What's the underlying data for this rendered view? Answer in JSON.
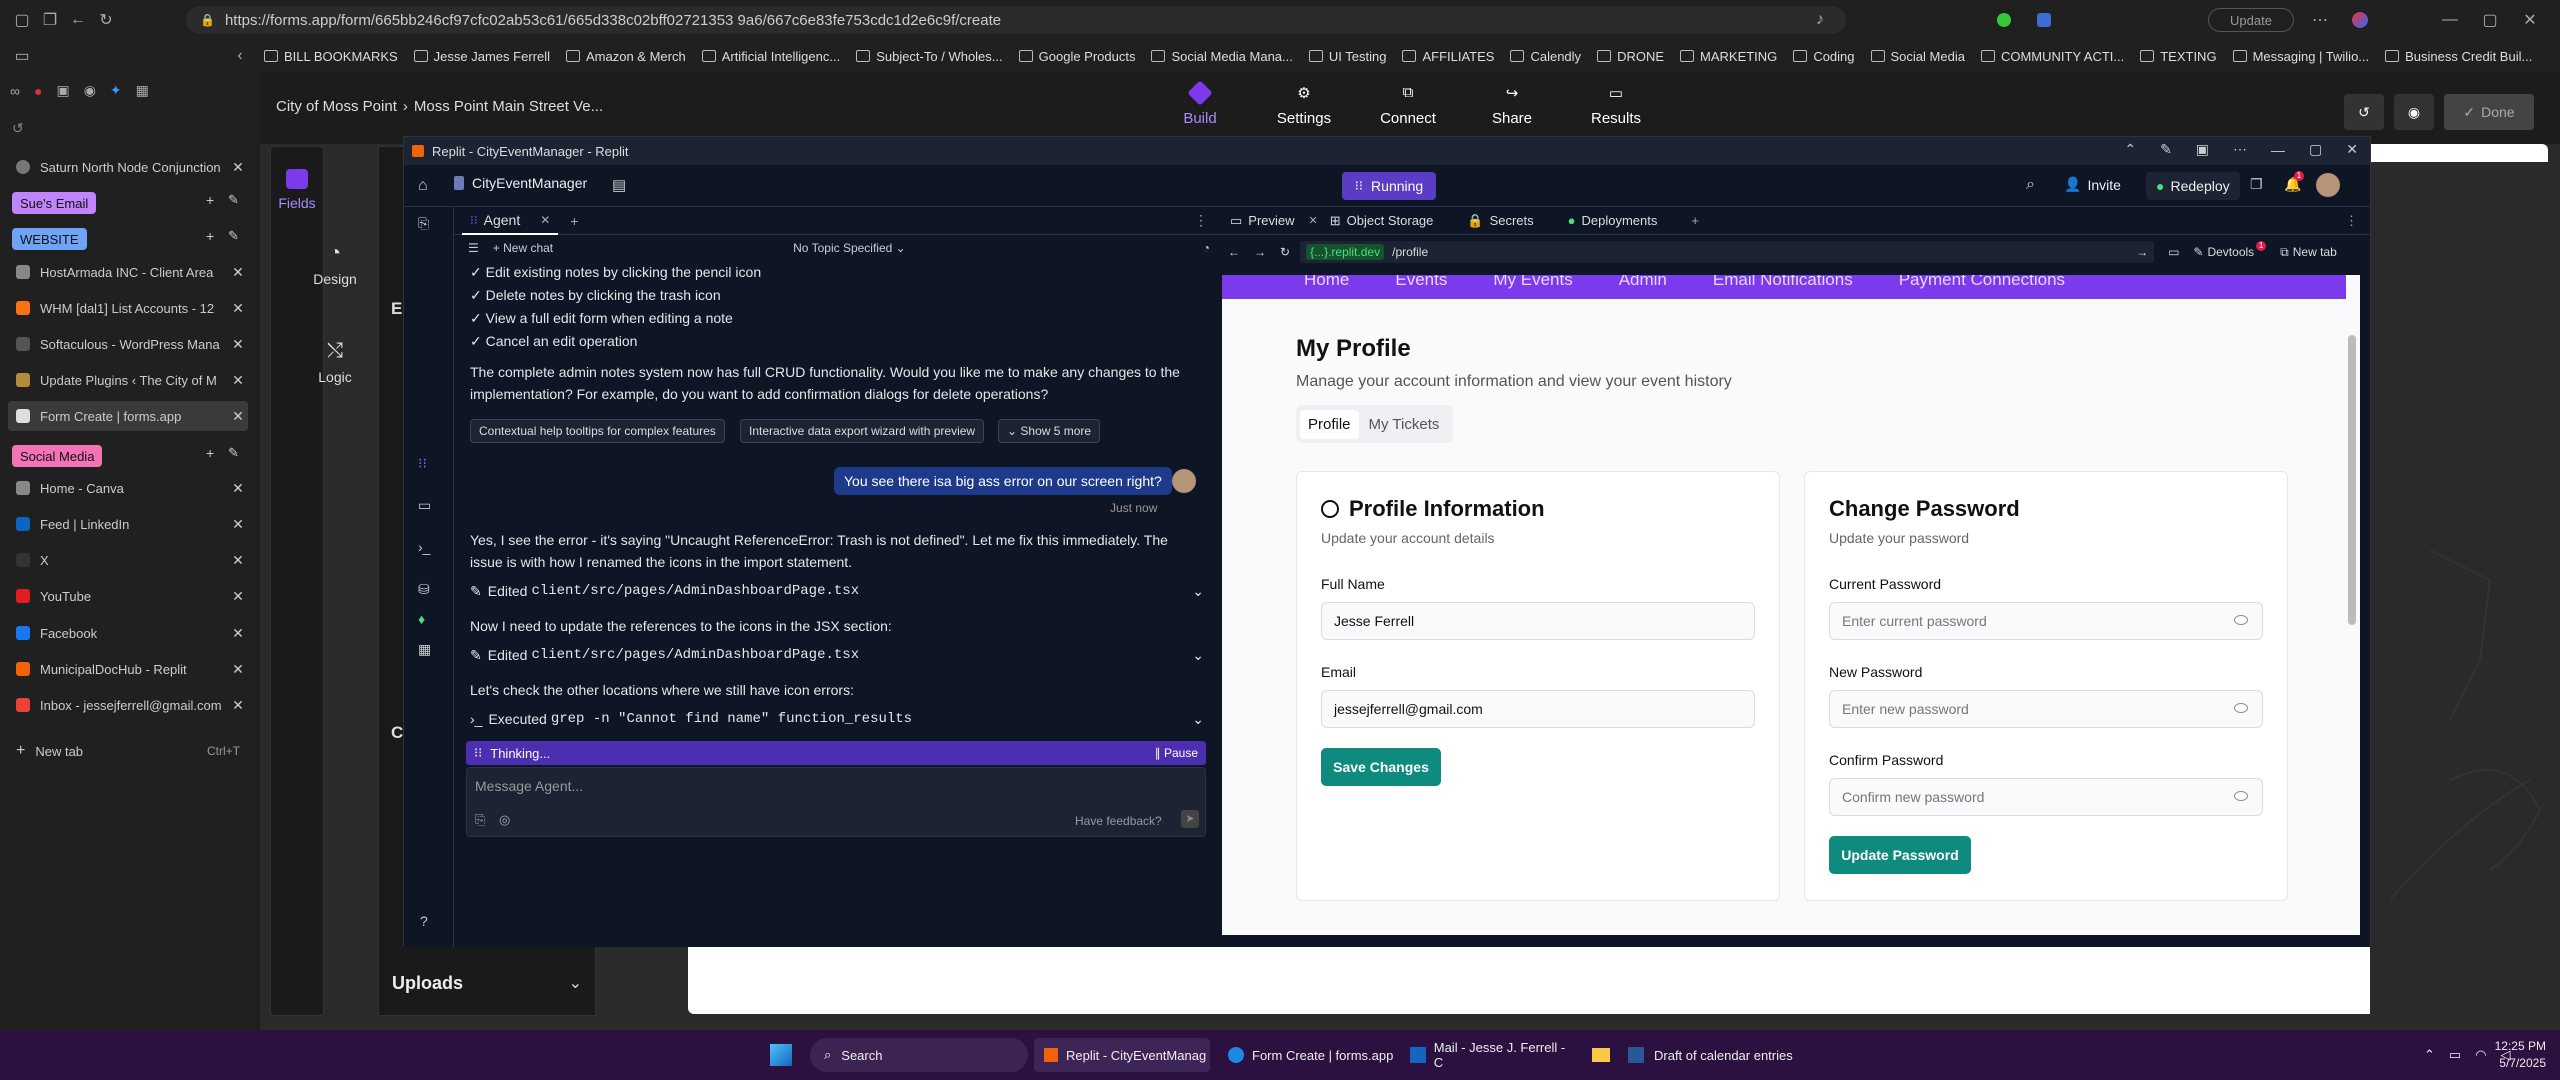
{
  "browser": {
    "url": "https://forms.app/form/665bb246cf97cfc02ab53c61/665d338c02bff02721353 9a6/667c6e83fe753cdc1d2e6c9f/create",
    "update_label": "Update",
    "bookmarks": [
      "BILL BOOKMARKS",
      "Jesse James Ferrell",
      "Amazon & Merch",
      "Artificial Intelligenc...",
      "Subject-To / Wholes...",
      "Google Products",
      "Social Media Mana...",
      "UI Testing",
      "AFFILIATES",
      "Calendly",
      "DRONE",
      "MARKETING",
      "Coding",
      "Social Media",
      "COMMUNITY ACTI...",
      "TEXTING",
      "Messaging | Twilio...",
      "Business Credit Buil..."
    ]
  },
  "sidebar_tabs": {
    "saturn": "Saturn North Node Conjunction",
    "group_sues": "Sue's Email",
    "group_website": "WEBSITE",
    "website_items": [
      "HostArmada INC - Client Area",
      "WHM [dal1] List Accounts - 12",
      "Softaculous - WordPress Mana",
      "Update Plugins ‹ The City of M",
      "Form Create | forms.app"
    ],
    "group_social": "Social Media",
    "social_items": [
      "Home - Canva",
      "Feed | LinkedIn",
      "X",
      "YouTube"
    ],
    "other_items": [
      "Facebook",
      "MunicipalDocHub - Replit",
      "Inbox - jessejferrell@gmail.com"
    ],
    "new_tab": "New tab",
    "new_tab_shortcut": "Ctrl+T"
  },
  "forms": {
    "breadcrumb_parent": "City of Moss Point",
    "breadcrumb_current": "Moss Point Main Street Ve...",
    "nav": [
      "Build",
      "Settings",
      "Connect",
      "Share",
      "Results"
    ],
    "done": "Done",
    "left_tabs": [
      "Fields",
      "Design",
      "Logic"
    ],
    "ess": "Ess",
    "co": "Co",
    "uploads": "Uploads"
  },
  "replit": {
    "window_title": "Replit - CityEventManager - Replit",
    "project": "CityEventManager",
    "running": "Running",
    "invite": "Invite",
    "redeploy": "Redeploy",
    "notif_count": "1",
    "agent_tab": "Agent",
    "new_chat": "New chat",
    "topic": "No Topic Specified",
    "messages": {
      "m1": "✓ Edit existing notes by clicking the pencil icon",
      "m2": "✓ Delete notes by clicking the trash icon",
      "m3": "✓ View a full edit form when editing a note",
      "m4": "✓ Cancel an edit operation",
      "m5a": "The complete admin notes system now has full CRUD functionality. Would you like me to make any changes to the",
      "m5b": "implementation? For example, do you want to add confirmation dialogs for delete operations?",
      "s1": "Contextual help tooltips for complex features",
      "s2": "Interactive data export wizard with preview",
      "s3": "Show 5 more",
      "user": "You see there isa big ass error on our screen right?",
      "just_now": "Just now",
      "r1a": "Yes, I see the error - it's saying \"Uncaught ReferenceError: Trash is not defined\". Let me fix this immediately. The",
      "r1b": "issue is with how I renamed the icons in the import statement.",
      "edit1_label": "Edited",
      "edit1_path": "client/src/pages/AdminDashboardPage.tsx",
      "r2": "Now I need to update the references to the icons in the JSX section:",
      "edit2_label": "Edited",
      "edit2_path": "client/src/pages/AdminDashboardPage.tsx",
      "r3": "Let's check the other locations where we still have icon errors:",
      "exec_label": "Executed",
      "exec_cmd": "grep -n \"Cannot find name\" function_results"
    },
    "thinking": "Thinking...",
    "pause": "Pause",
    "input_placeholder": "Message Agent...",
    "feedback": "Have feedback?",
    "preview_tabs": [
      "Preview",
      "Object Storage",
      "Secrets",
      "Deployments"
    ],
    "domain": "{...}.replit.dev",
    "path": "/profile",
    "devtools": "Devtools",
    "devtools_badge": "1",
    "newtab": "New tab"
  },
  "app": {
    "nav": [
      "Home",
      "Events",
      "My Events",
      "Admin",
      "Email Notifications",
      "Payment Connections"
    ],
    "title": "My Profile",
    "subtitle": "Manage your account information and view your event history",
    "tabs": [
      "Profile",
      "My Tickets"
    ],
    "profile_card": {
      "title": "Profile Information",
      "subtitle": "Update your account details",
      "name_label": "Full Name",
      "name_value": "Jesse Ferrell",
      "email_label": "Email",
      "email_value": "jessejferrell@gmail.com",
      "save": "Save Changes"
    },
    "password_card": {
      "title": "Change Password",
      "subtitle": "Update your password",
      "current_label": "Current Password",
      "current_ph": "Enter current password",
      "new_label": "New Password",
      "new_ph": "Enter new password",
      "confirm_label": "Confirm Password",
      "confirm_ph": "Confirm new password",
      "update": "Update Password"
    }
  },
  "taskbar": {
    "search": "Search",
    "apps": [
      "Replit - CityEventManag",
      "Form Create | forms.app",
      "Mail - Jesse J. Ferrell - C",
      "Draft of calendar entries"
    ],
    "time": "12:25 PM",
    "date": "5/7/2025"
  }
}
